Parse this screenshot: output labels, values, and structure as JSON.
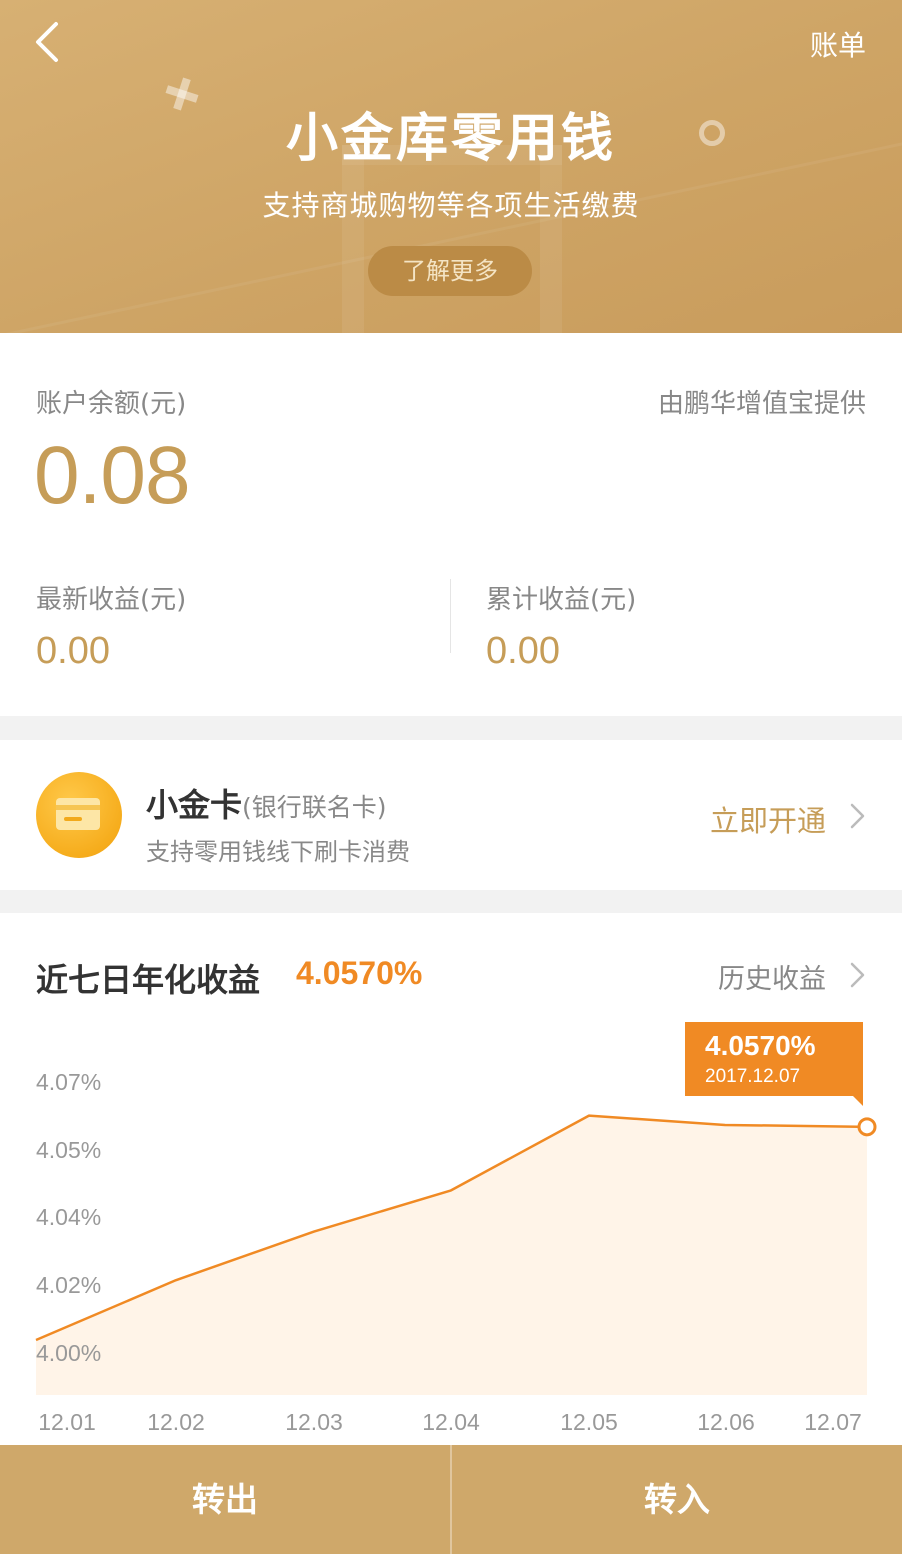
{
  "header": {
    "back_icon": "chevron-left-icon",
    "bill_label": "账单",
    "title": "小金库零用钱",
    "subtitle": "支持商城购物等各项生活缴费",
    "learn_more_label": "了解更多"
  },
  "balance": {
    "label": "账户余额(元)",
    "provider": "由鹏华增值宝提供",
    "value": "0.08",
    "latest_earnings_label": "最新收益(元)",
    "latest_earnings_value": "0.00",
    "total_earnings_label": "累计收益(元)",
    "total_earnings_value": "0.00"
  },
  "card_promo": {
    "title": "小金卡",
    "title_note": "(银行联名卡)",
    "description": "支持零用钱线下刷卡消费",
    "action_label": "立即开通",
    "icon": "bank-card-icon"
  },
  "yield_section": {
    "title": "近七日年化收益",
    "rate": "4.0570%",
    "history_label": "历史收益",
    "tooltip": {
      "rate": "4.0570%",
      "date": "2017.12.07"
    }
  },
  "chart_data": {
    "type": "area",
    "title": "",
    "xlabel": "",
    "ylabel": "",
    "categories": [
      "12.01",
      "12.02",
      "12.03",
      "12.04",
      "12.05",
      "12.06",
      "12.07"
    ],
    "values": [
      4.0,
      4.016,
      4.029,
      4.04,
      4.06,
      4.0575,
      4.057
    ],
    "y_ticks": [
      "4.07%",
      "4.05%",
      "4.04%",
      "4.02%",
      "4.00%"
    ],
    "colors": {
      "line": "#f08a24",
      "area": "#fff4e8"
    },
    "grid": false,
    "highlight_index": 6
  },
  "bottom_bar": {
    "transfer_out_label": "转出",
    "transfer_in_label": "转入"
  },
  "colors": {
    "brand_gold": "#c69d58",
    "accent_orange": "#f08a24",
    "bottom_bar": "#cfa86a"
  }
}
